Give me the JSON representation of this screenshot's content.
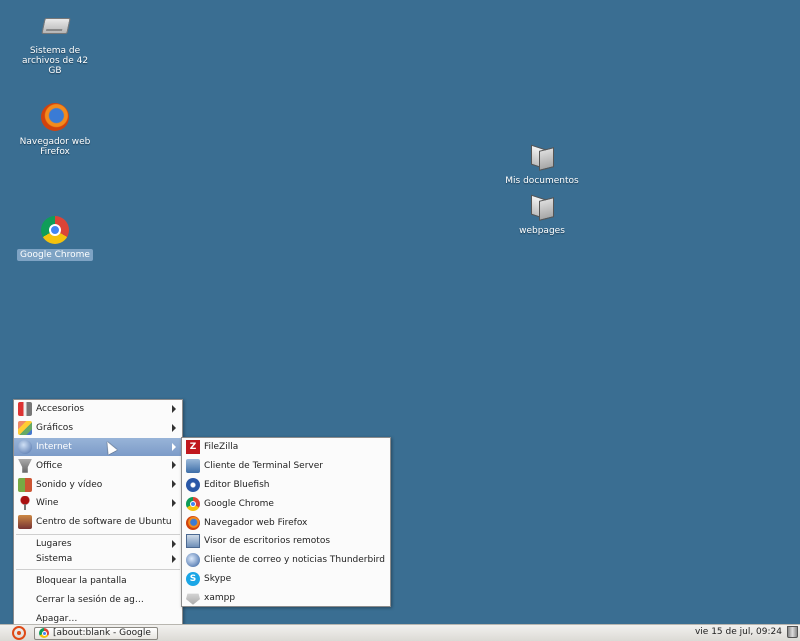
{
  "desktop": {
    "icons": [
      {
        "label": "Sistema de archivos de 42 GB",
        "icon": "drive-icon"
      },
      {
        "label": "Navegador web Firefox",
        "icon": "firefox-icon"
      },
      {
        "label": "Google Chrome",
        "icon": "chrome-icon"
      },
      {
        "label": "Mis documentos",
        "icon": "folder-icon"
      },
      {
        "label": "webpages",
        "icon": "folder-icon"
      }
    ]
  },
  "main_menu": {
    "items": [
      {
        "label": "Accesorios",
        "icon": "accessories-icon",
        "submenu": true
      },
      {
        "label": "Gráficos",
        "icon": "graphics-icon",
        "submenu": true
      },
      {
        "label": "Internet",
        "icon": "internet-icon",
        "submenu": true,
        "highlighted": true
      },
      {
        "label": "Office",
        "icon": "office-icon",
        "submenu": true
      },
      {
        "label": "Sonido y vídeo",
        "icon": "sound-video-icon",
        "submenu": true
      },
      {
        "label": "Wine",
        "icon": "wine-icon",
        "submenu": true
      },
      {
        "label": "Centro de software de Ubuntu",
        "icon": "software-center-icon",
        "submenu": false
      }
    ],
    "places_items": [
      {
        "label": "Lugares",
        "submenu": true
      },
      {
        "label": "Sistema",
        "submenu": true
      }
    ],
    "session_items": [
      {
        "label": "Bloquear la pantalla"
      },
      {
        "label": "Cerrar la sesión de ag…"
      },
      {
        "label": "Apagar…"
      }
    ]
  },
  "internet_submenu": {
    "items": [
      {
        "label": "FileZilla",
        "icon": "filezilla-icon"
      },
      {
        "label": "Cliente de Terminal Server",
        "icon": "terminal-server-icon"
      },
      {
        "label": "Editor Bluefish",
        "icon": "bluefish-icon"
      },
      {
        "label": "Google Chrome",
        "icon": "chrome-icon"
      },
      {
        "label": "Navegador web Firefox",
        "icon": "firefox-icon"
      },
      {
        "label": "Visor de escritorios remotos",
        "icon": "remote-desktop-icon"
      },
      {
        "label": "Cliente de correo y noticias Thunderbird",
        "icon": "thunderbird-icon"
      },
      {
        "label": "Skype",
        "icon": "skype-icon"
      },
      {
        "label": "xampp",
        "icon": "xampp-icon"
      }
    ]
  },
  "taskbar": {
    "window_button": "[about:blank - Google …",
    "clock": "vie 15 de jul, 09:24"
  },
  "colors": {
    "desktop_bg": "#3a6e92",
    "menu_highlight": "#7c9bc8"
  }
}
